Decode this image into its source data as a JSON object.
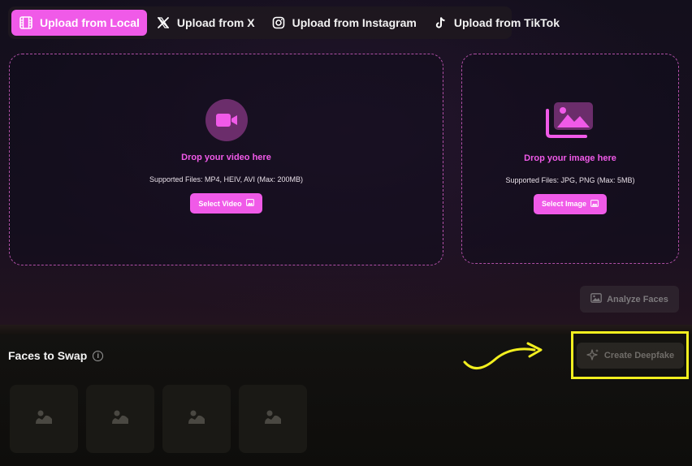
{
  "tabs": [
    {
      "label": "Upload from Local",
      "icon": "film-icon",
      "active": true
    },
    {
      "label": "Upload from X",
      "icon": "x-logo-icon",
      "active": false
    },
    {
      "label": "Upload from Instagram",
      "icon": "instagram-icon",
      "active": false
    },
    {
      "label": "Upload from TikTok",
      "icon": "tiktok-icon",
      "active": false
    }
  ],
  "video_drop": {
    "title": "Drop your video here",
    "supported": "Supported Files: MP4, HEIV, AVI (Max: 200MB)",
    "button_label": "Select Video",
    "icon": "video-camera-icon"
  },
  "image_drop": {
    "title": "Drop your image here",
    "supported": "Supported Files: JPG, PNG (Max: 5MB)",
    "button_label": "Select Image",
    "icon": "image-stack-icon"
  },
  "analyze": {
    "label": "Analyze Faces",
    "icon": "image-icon"
  },
  "faces": {
    "title": "Faces to Swap",
    "info_glyph": "i",
    "create_label": "Create Deepfake",
    "create_icon": "sparkle-icon",
    "thumbnails": [
      "face-placeholder-icon",
      "face-placeholder-icon",
      "face-placeholder-icon",
      "face-placeholder-icon"
    ]
  },
  "colors": {
    "accent": "#f05ae8",
    "highlight": "#f2ef1f",
    "disabled_text": "#7d7a7d"
  }
}
